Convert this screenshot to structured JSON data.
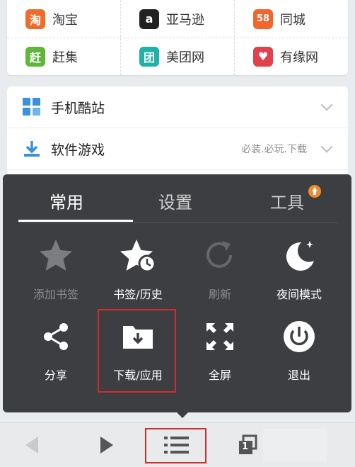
{
  "quick_links": [
    {
      "label": "淘宝",
      "icon": "taobao-icon",
      "glyph": "淘",
      "color": "#f06c2c"
    },
    {
      "label": "亚马逊",
      "icon": "amazon-icon",
      "glyph": "a",
      "color": "#222222"
    },
    {
      "label": "同城",
      "icon": "tongcheng-icon",
      "glyph": "58",
      "color": "#f2662b"
    },
    {
      "label": "赶集",
      "icon": "ganji-icon",
      "glyph": "赶",
      "color": "#5fb63a"
    },
    {
      "label": "美团网",
      "icon": "meituan-icon",
      "glyph": "团",
      "color": "#21b2a7"
    },
    {
      "label": "有缘网",
      "icon": "youyuan-icon",
      "glyph": "♥",
      "color": "#e0414c"
    }
  ],
  "categories": [
    {
      "label": "手机酷站",
      "hint": ""
    },
    {
      "label": "软件游戏",
      "hint": "必装.必玩.下载"
    }
  ],
  "menu": {
    "tabs": [
      "常用",
      "设置",
      "工具"
    ],
    "active_tab": "常用",
    "items": [
      {
        "label": "添加书签",
        "icon": "star-add-icon",
        "enabled": false
      },
      {
        "label": "书签/历史",
        "icon": "star-clock-icon",
        "enabled": true
      },
      {
        "label": "刷新",
        "icon": "refresh-icon",
        "enabled": false
      },
      {
        "label": "夜间模式",
        "icon": "moon-icon",
        "enabled": true
      },
      {
        "label": "分享",
        "icon": "share-icon",
        "enabled": true
      },
      {
        "label": "下载/应用",
        "icon": "download-folder-icon",
        "enabled": true
      },
      {
        "label": "全屏",
        "icon": "fullscreen-icon",
        "enabled": true
      },
      {
        "label": "退出",
        "icon": "power-icon",
        "enabled": true
      }
    ]
  },
  "bottom_bar": {
    "back": "back-arrow-icon",
    "forward": "forward-arrow-icon",
    "menu": "menu-list-icon",
    "windows": "windows-icon",
    "window_count": "1"
  }
}
